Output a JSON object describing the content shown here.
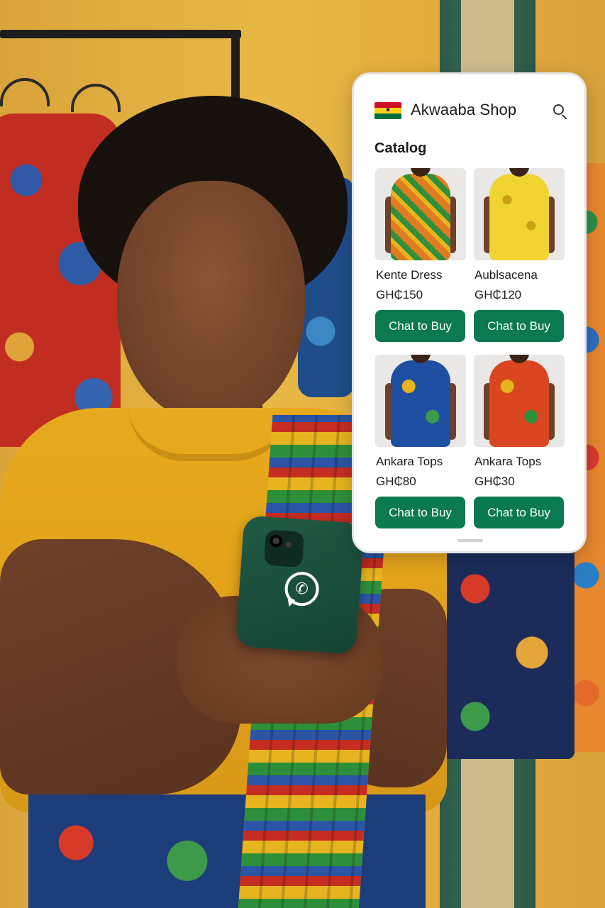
{
  "app": {
    "shop_name": "Akwaaba Shop",
    "flag_icon": "ghana-flag-icon",
    "search_icon": "search-icon"
  },
  "catalog": {
    "heading": "Catalog",
    "products": [
      {
        "name": "Kente Dress",
        "price": "GH₵150",
        "button_label": "Chat to Buy"
      },
      {
        "name": "Aublsacena",
        "price": "GH₵120",
        "button_label": "Chat to Buy"
      },
      {
        "name": "Ankara Tops",
        "price": "GH₵80",
        "button_label": "Chat to Buy"
      },
      {
        "name": "Ankara Tops",
        "price": "GH₵30",
        "button_label": "Chat to Buy"
      }
    ]
  },
  "held_phone": {
    "logo_icon": "whatsapp-icon"
  },
  "colors": {
    "button_green": "#0b7a4e",
    "flag_red": "#ce1126",
    "flag_gold": "#fcd116",
    "flag_green": "#006b3f"
  }
}
